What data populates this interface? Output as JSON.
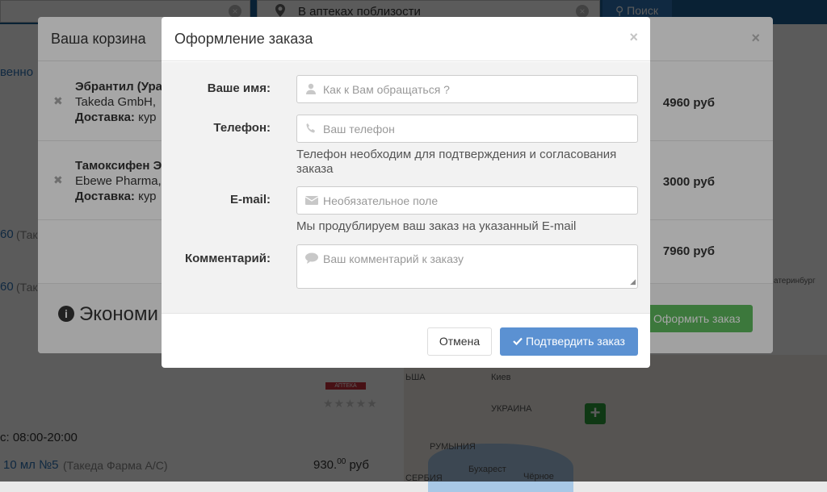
{
  "background": {
    "search_location_text": "В аптеках поблизости",
    "search_button": "Поиск",
    "clear_icon": "x-circle-icon",
    "left_snippets": [
      "венно",
      "60",
      "(Таке",
      "60",
      "(Так"
    ],
    "hours": "с: 08:00-20:00",
    "product_line": "10 мл №5",
    "product_maker": "(Такеда Фарма А/С)",
    "product_price": "930.",
    "product_price_cents": "00",
    "product_currency": "руб",
    "pharmacy_logo": "АПТЕКА",
    "rating": "★★★★★",
    "map_labels": [
      "Киев",
      "УКРАИНА",
      "РУМЫНИЯ",
      "Бухарест",
      "Чёрное",
      "ЬША",
      "СЕРБИЯ",
      "атеринбург"
    ]
  },
  "cart": {
    "title": "Ваша корзина",
    "close": "×",
    "items": [
      {
        "name": "Эбрантил (Ура",
        "maker": "Takeda GmbH,",
        "delivery_label": "Доставка:",
        "delivery_value": "кур",
        "price": "4960 руб",
        "remove": "✖"
      },
      {
        "name": "Тамоксифен Э",
        "maker": "Ebewe Pharma,",
        "delivery_label": "Доставка:",
        "delivery_value": "кур",
        "price": "3000 руб",
        "remove": "✖"
      }
    ],
    "total": "7960 руб",
    "savings_title": "Экономи",
    "order_button": "Оформить заказ"
  },
  "checkout": {
    "title": "Оформление заказа",
    "close": "×",
    "fields": {
      "name": {
        "label": "Ваше имя:",
        "placeholder": "Как к Вам обращаться ?",
        "value": "",
        "icon": "user-icon"
      },
      "phone": {
        "label": "Телефон:",
        "placeholder": "Ваш телефон",
        "value": "",
        "icon": "phone-icon",
        "help": "Телефон необходим для подтверждения и согласования заказа"
      },
      "email": {
        "label": "E-mail:",
        "placeholder": "Необязательное поле",
        "value": "",
        "icon": "envelope-icon",
        "help": "Мы продублируем ваш заказ на указанный E-mail"
      },
      "comment": {
        "label": "Комментарий:",
        "placeholder": "Ваш комментарий к заказу",
        "value": "",
        "icon": "comment-icon"
      }
    },
    "cancel_button": "Отмена",
    "confirm_button": "Подтвердить заказ",
    "confirm_icon": "check-icon"
  },
  "colors": {
    "primary": "#5b91d2",
    "success": "#5cb85c",
    "header_blue": "#1b5d92"
  }
}
